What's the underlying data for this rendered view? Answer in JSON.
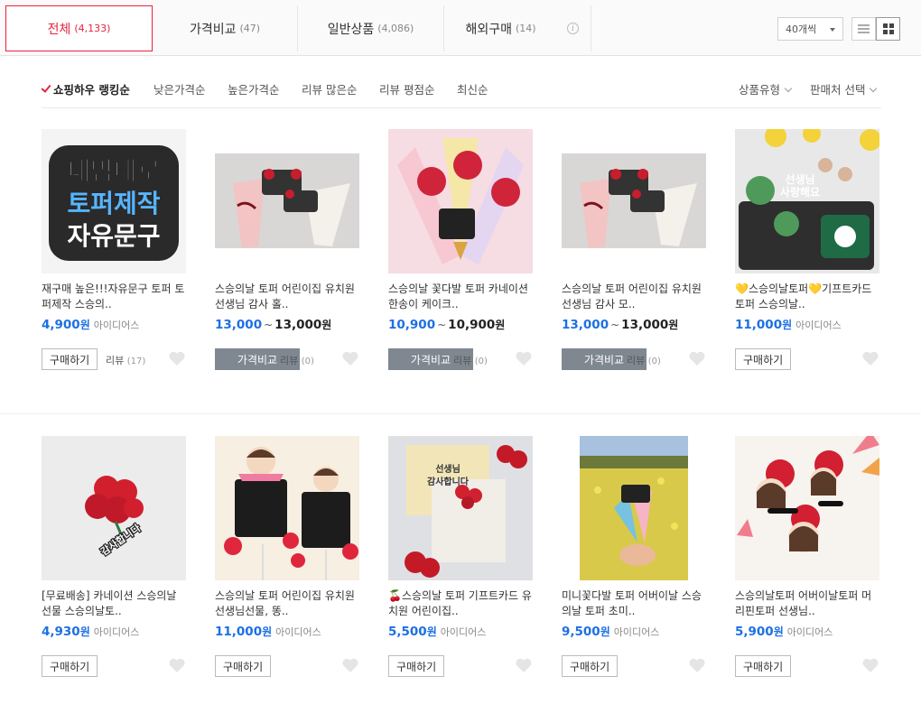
{
  "tabs": [
    {
      "label": "전체",
      "count": "(4,133)"
    },
    {
      "label": "가격비교",
      "count": "(47)"
    },
    {
      "label": "일반상품",
      "count": "(4,086)"
    },
    {
      "label": "해외구매",
      "count": "(14)"
    }
  ],
  "per_page": "40개씩",
  "sort": {
    "items": [
      "쇼핑하우 랭킹순",
      "낮은가격순",
      "높은가격순",
      "리뷰 많은순",
      "리뷰 평점순",
      "최신순"
    ],
    "filters": [
      "상품유형",
      "판매처 선택"
    ]
  },
  "labels": {
    "buy": "구매하기",
    "compare": "가격비교",
    "review": "리뷰",
    "won": "원",
    "tilde": "~"
  },
  "products": [
    {
      "title": "재구매 높은!!!자유문구 토퍼 토퍼제작 스승의..",
      "price": "4,900",
      "seller": "아이디어스",
      "button": "buy",
      "reviews": "리뷰",
      "review_count": "(17)"
    },
    {
      "title": "스승의날 토퍼 어린이집 유치원 선생님 감사 홀..",
      "price": "13,000",
      "price_max": "13,000",
      "button": "compare",
      "reviews": "리뷰",
      "review_count": "(0)"
    },
    {
      "title": "스승의날 꽃다발 토퍼 카네이션 한송이 케이크..",
      "price": "10,900",
      "price_max": "10,900",
      "button": "compare",
      "reviews": "리뷰",
      "review_count": "(0)"
    },
    {
      "title": "스승의날 토퍼 어린이집 유치원 선생님 감사 모..",
      "price": "13,000",
      "price_max": "13,000",
      "button": "compare",
      "reviews": "리뷰",
      "review_count": "(0)"
    },
    {
      "title": "💛스승의날토퍼💛기프트카드토퍼 스승의날..",
      "price": "11,000",
      "seller": "아이디어스",
      "button": "buy"
    },
    {
      "title": "[무료배송] 카네이션 스승의날선물 스승의날토..",
      "price": "4,930",
      "seller": "아이디어스",
      "button": "buy"
    },
    {
      "title": "스승의날 토퍼 어린이집 유치원 선생님선물, 똥..",
      "price": "11,000",
      "seller": "아이디어스",
      "button": "buy"
    },
    {
      "title": "🍒스승의날 토퍼 기프트카드 유치원 어린이집..",
      "price": "5,500",
      "seller": "아이디어스",
      "button": "buy"
    },
    {
      "title": "미니꽃다발 토퍼 어버이날 스승의날 토퍼 초미..",
      "price": "9,500",
      "seller": "아이디어스",
      "button": "buy"
    },
    {
      "title": "스승의날토퍼 어버이날토퍼 머리핀토퍼 선생님..",
      "price": "5,900",
      "seller": "아이디어스",
      "button": "buy"
    }
  ],
  "image_text": {
    "p1": [
      "내맘대로",
      "토퍼제작",
      "자유문구"
    ],
    "p5": [
      "선생님",
      "사랑해요"
    ],
    "p6": [
      "감사합니다"
    ],
    "p8": [
      "선생님",
      "감사합니다"
    ]
  },
  "colors": {
    "accent": "#e6233f",
    "price": "#1d70e3",
    "compare_btn": "#7f8791"
  }
}
